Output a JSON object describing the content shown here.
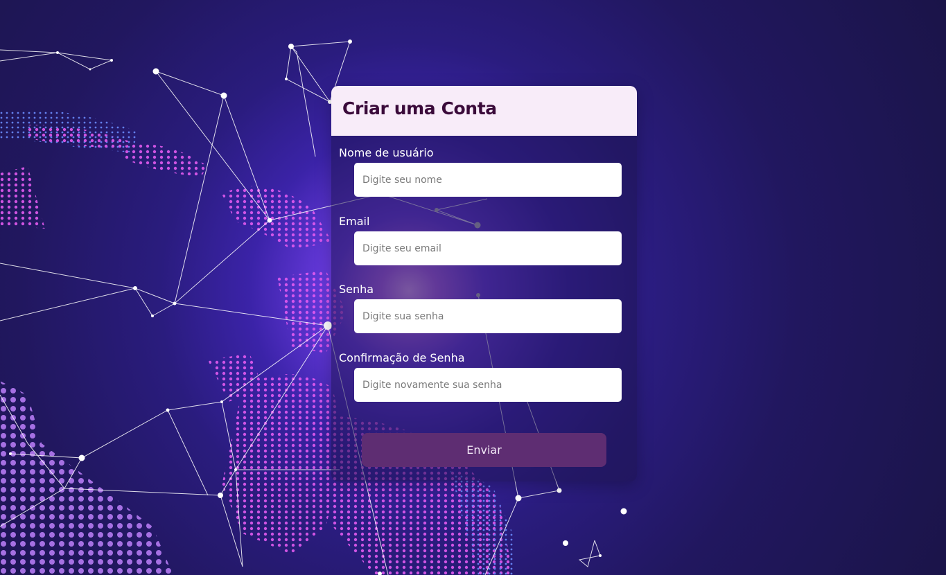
{
  "form": {
    "title": "Criar uma Conta",
    "fields": [
      {
        "label": "Nome de usuário",
        "placeholder": "Digite seu nome"
      },
      {
        "label": "Email",
        "placeholder": "Digite seu email"
      },
      {
        "label": "Senha",
        "placeholder": "Digite sua senha"
      },
      {
        "label": "Confirmação de Senha",
        "placeholder": "Digite novamente sua senha"
      }
    ],
    "submit_label": "Enviar"
  },
  "colors": {
    "header_bg": "#f8ecf9",
    "title_text": "#3a0a3a",
    "button_bg": "#5e2d72",
    "background_dark": "#1a1447",
    "accent_glow": "#b565f0",
    "dot_pink": "#e35bf0"
  }
}
